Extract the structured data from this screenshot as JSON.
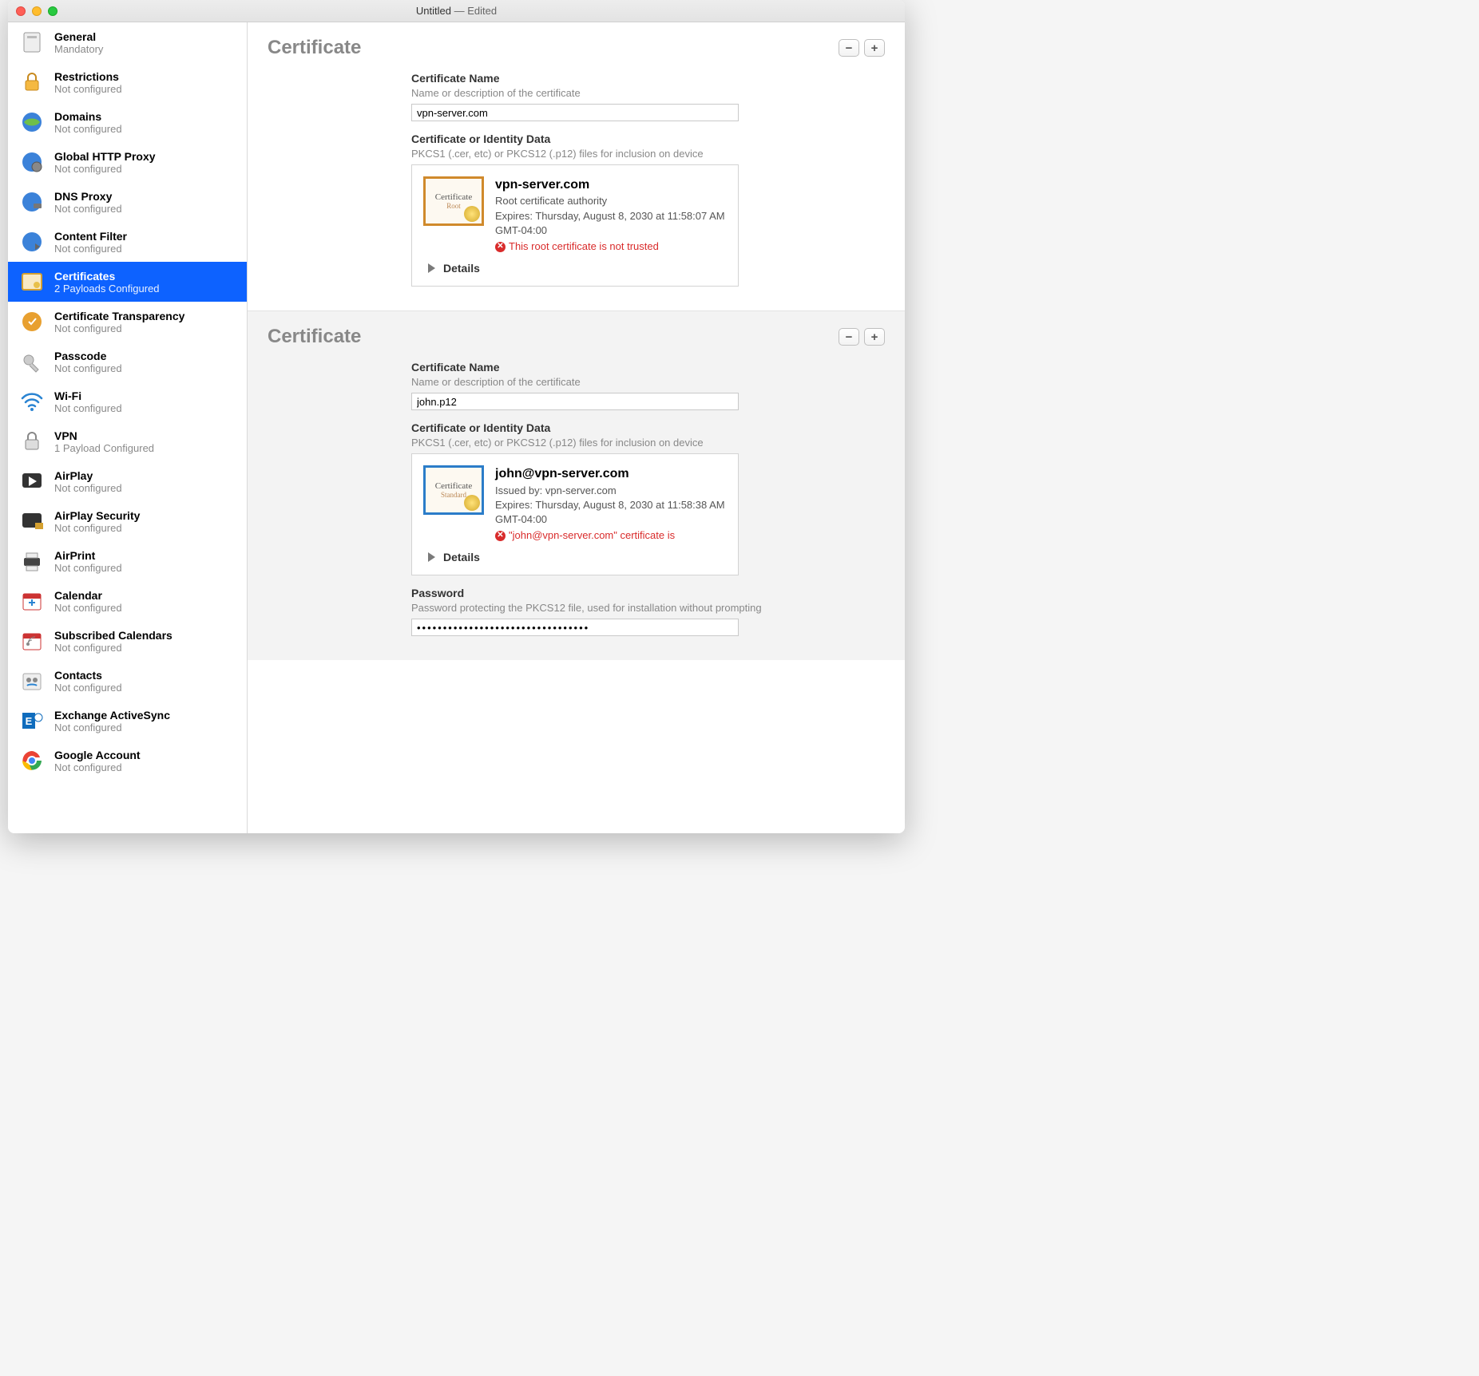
{
  "window": {
    "title": "Untitled",
    "status": "— Edited"
  },
  "sidebar": {
    "items": [
      {
        "title": "General",
        "sub": "Mandatory"
      },
      {
        "title": "Restrictions",
        "sub": "Not configured"
      },
      {
        "title": "Domains",
        "sub": "Not configured"
      },
      {
        "title": "Global HTTP Proxy",
        "sub": "Not configured"
      },
      {
        "title": "DNS Proxy",
        "sub": "Not configured"
      },
      {
        "title": "Content Filter",
        "sub": "Not configured"
      },
      {
        "title": "Certificates",
        "sub": "2 Payloads Configured"
      },
      {
        "title": "Certificate Transparency",
        "sub": "Not configured"
      },
      {
        "title": "Passcode",
        "sub": "Not configured"
      },
      {
        "title": "Wi-Fi",
        "sub": "Not configured"
      },
      {
        "title": "VPN",
        "sub": "1 Payload Configured"
      },
      {
        "title": "AirPlay",
        "sub": "Not configured"
      },
      {
        "title": "AirPlay Security",
        "sub": "Not configured"
      },
      {
        "title": "AirPrint",
        "sub": "Not configured"
      },
      {
        "title": "Calendar",
        "sub": "Not configured"
      },
      {
        "title": "Subscribed Calendars",
        "sub": "Not configured"
      },
      {
        "title": "Contacts",
        "sub": "Not configured"
      },
      {
        "title": "Exchange ActiveSync",
        "sub": "Not configured"
      },
      {
        "title": "Google Account",
        "sub": "Not configured"
      }
    ],
    "selected_index": 6
  },
  "panels": [
    {
      "heading": "Certificate",
      "cert_name": {
        "label": "Certificate Name",
        "desc": "Name or description of the certificate",
        "value": "vpn-server.com"
      },
      "cert_data": {
        "label": "Certificate or Identity Data",
        "desc": "PKCS1 (.cer, etc) or PKCS12 (.p12) files for inclusion on device"
      },
      "cert_info": {
        "name": "vpn-server.com",
        "line1": "Root certificate authority",
        "line2": "Expires: Thursday, August 8, 2030 at 11:58:07 AM GMT-04:00",
        "error": "This root certificate is not trusted",
        "thumb_sub": "Root"
      },
      "details": "Details"
    },
    {
      "heading": "Certificate",
      "cert_name": {
        "label": "Certificate Name",
        "desc": "Name or description of the certificate",
        "value": "john.p12"
      },
      "cert_data": {
        "label": "Certificate or Identity Data",
        "desc": "PKCS1 (.cer, etc) or PKCS12 (.p12) files for inclusion on device"
      },
      "cert_info": {
        "name": "john@vpn-server.com",
        "line1": "Issued by: vpn-server.com",
        "line2": "Expires: Thursday, August 8, 2030 at 11:58:38 AM GMT-04:00",
        "error": "\"john@vpn-server.com\" certificate is",
        "thumb_sub": "Standard"
      },
      "details": "Details",
      "password": {
        "label": "Password",
        "desc": "Password protecting the PKCS12 file, used for installation without prompting",
        "value": "•••••••••••••••••••••••••••••••••"
      }
    }
  ],
  "buttons": {
    "minus": "−",
    "plus": "+",
    "thumb_title": "Certificate"
  }
}
